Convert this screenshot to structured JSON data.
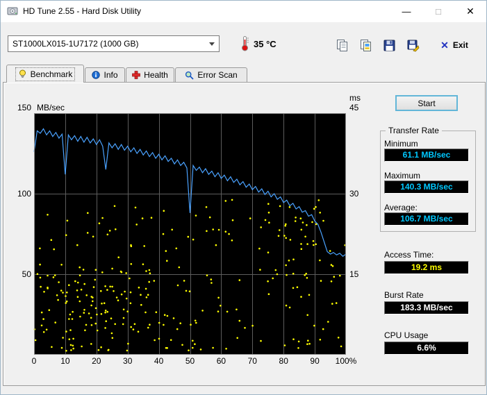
{
  "window": {
    "title": "HD Tune 2.55 - Hard Disk Utility",
    "controls": {
      "minimize": "—",
      "maximize": "□",
      "close": "✕"
    }
  },
  "toolbar": {
    "device_select": {
      "value": "ST1000LX015-1U7172 (1000 GB)"
    },
    "temperature": "35 °C",
    "buttons": [
      {
        "name": "copy-text"
      },
      {
        "name": "copy-image"
      },
      {
        "name": "save-screenshot"
      },
      {
        "name": "save-as"
      }
    ],
    "exit_glyph": "✕",
    "exit_label": "Exit"
  },
  "tabs": [
    {
      "label": "Benchmark",
      "active": true
    },
    {
      "label": "Info",
      "active": false
    },
    {
      "label": "Health",
      "active": false
    },
    {
      "label": "Error Scan",
      "active": false
    }
  ],
  "panel": {
    "start_button": "Start",
    "transfer_rate": {
      "title": "Transfer Rate",
      "minimum_label": "Minimum",
      "minimum_value": "61.1 MB/sec",
      "maximum_label": "Maximum",
      "maximum_value": "140.3 MB/sec",
      "average_label": "Average:",
      "average_value": "106.7 MB/sec"
    },
    "access_time_label": "Access Time:",
    "access_time_value": "19.2 ms",
    "burst_rate_label": "Burst Rate",
    "burst_rate_value": "183.3 MB/sec",
    "cpu_usage_label": "CPU Usage",
    "cpu_usage_value": "6.6%"
  },
  "chart_data": {
    "type": "line_scatter",
    "title": "HD Tune benchmark: transfer rate line with access-time scatter",
    "colors": {
      "plot_bg": "#000000",
      "grid": "#5d5d5d",
      "plot_border": "#8a8a8a"
    },
    "x_axis": {
      "range": [
        0,
        100
      ],
      "ticks": [
        0,
        10,
        20,
        30,
        40,
        50,
        60,
        70,
        80,
        90,
        100
      ],
      "suffix": "%"
    },
    "y_left": {
      "label": "MB/sec",
      "range": [
        0,
        150
      ],
      "ticks": [
        150,
        100,
        50
      ]
    },
    "y_right": {
      "label": "ms",
      "range": [
        0,
        45
      ],
      "ticks": [
        45,
        30,
        15
      ]
    },
    "legend": "none",
    "grid": true,
    "series": [
      {
        "name": "transfer_rate_mb_per_s",
        "type": "line",
        "axis": "left",
        "color": "#4aa2ff",
        "x_start": 0,
        "x_end": 100,
        "values": [
          126,
          139,
          137.5,
          140.3,
          136.5,
          139,
          135.5,
          138,
          134.5,
          137,
          112,
          136.5,
          133.5,
          136,
          132.5,
          135.5,
          132,
          135,
          131.5,
          134,
          130.5,
          133.5,
          129.5,
          115,
          131.5,
          128.5,
          131,
          127.5,
          130.5,
          127,
          129.5,
          126,
          128.5,
          125,
          127.5,
          124,
          126.5,
          123,
          125.5,
          122,
          124.5,
          121,
          123.5,
          120,
          122,
          118.5,
          121,
          117.5,
          119.5,
          116,
          88,
          117.5,
          114.5,
          116.5,
          113,
          115.5,
          112,
          114,
          110.5,
          113,
          109.5,
          111.5,
          108,
          110.5,
          107,
          109,
          105.5,
          107.5,
          104,
          106,
          102.5,
          104.5,
          101,
          103,
          99.5,
          101.5,
          98,
          100,
          96.5,
          98,
          94.5,
          96,
          92.5,
          94,
          90.5,
          92,
          88.5,
          89.5,
          86,
          87,
          83,
          81,
          76,
          70,
          64,
          62.5,
          63.5,
          62,
          63,
          61.1,
          62.5
        ]
      },
      {
        "name": "access_time_ms",
        "type": "scatter",
        "axis": "right",
        "color": "#ffff00",
        "generated": {
          "seed": 20,
          "groups": [
            {
              "count": 170,
              "x_range": [
                0,
                100
              ],
              "ms_range": [
                4.5,
                28
              ],
              "bias": 1.3
            },
            {
              "count": 70,
              "x_range": [
                0,
                38
              ],
              "ms_range": [
                4,
                17
              ],
              "bias": 1.0
            },
            {
              "count": 45,
              "x_range": [
                0,
                100
              ],
              "ms_range": [
                0.7,
                3.2
              ],
              "bias": 1.0
            },
            {
              "count": 25,
              "x_range": [
                55,
                100
              ],
              "ms_range": [
                20,
                29
              ],
              "bias": 1.0
            }
          ]
        }
      }
    ],
    "summary": {
      "transfer_min_mb_s": 61.1,
      "transfer_max_mb_s": 140.3,
      "transfer_avg_mb_s": 106.7,
      "access_time_ms": 19.2,
      "burst_rate_mb_s": 183.3,
      "cpu_usage_pct": 6.6
    }
  }
}
